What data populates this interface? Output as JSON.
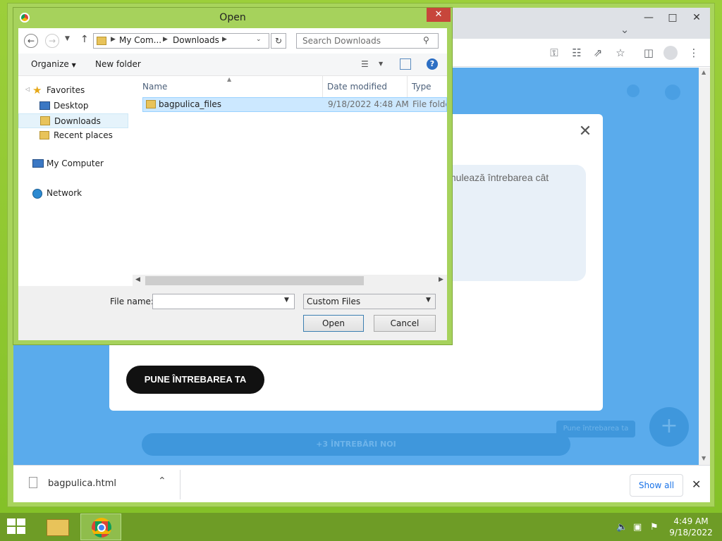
{
  "dialog": {
    "title": "Open",
    "close_glyph": "✕",
    "breadcrumb": [
      "My Com...",
      "Downloads"
    ],
    "search_placeholder": "Search Downloads",
    "organize_label": "Organize",
    "new_folder_label": "New folder",
    "nav": {
      "favorites_label": "Favorites",
      "favorites": [
        {
          "label": "Desktop",
          "icon": "desktop-icon"
        },
        {
          "label": "Downloads",
          "icon": "downloads-folder-icon",
          "selected": true
        },
        {
          "label": "Recent places",
          "icon": "recent-places-icon"
        }
      ],
      "my_computer_label": "My Computer",
      "network_label": "Network"
    },
    "columns": {
      "name": "Name",
      "date": "Date modified",
      "type": "Type"
    },
    "files": [
      {
        "name": "bagpulica_files",
        "date": "9/18/2022 4:48 AM",
        "type": "File folder",
        "icon": "folder-icon"
      }
    ],
    "file_name_label": "File name:",
    "file_name_value": "",
    "file_type_value": "Custom Files",
    "open_label": "Open",
    "cancel_label": "Cancel"
  },
  "page": {
    "bubble_text": "mulează întrebarea cât",
    "ask_button_label": "PUNE ÎNTREBAREA TA",
    "new_questions_label": "+3 ÎNTREBĂRI NOI",
    "fab_label": "Pune întrebarea ta",
    "fab_glyph": "+",
    "modal_close_glyph": "✕"
  },
  "download_bar": {
    "file_name": "bagpulica.html",
    "show_all_label": "Show all",
    "close_glyph": "✕"
  },
  "taskbar": {
    "time": "4:49 AM",
    "date": "9/18/2022"
  }
}
